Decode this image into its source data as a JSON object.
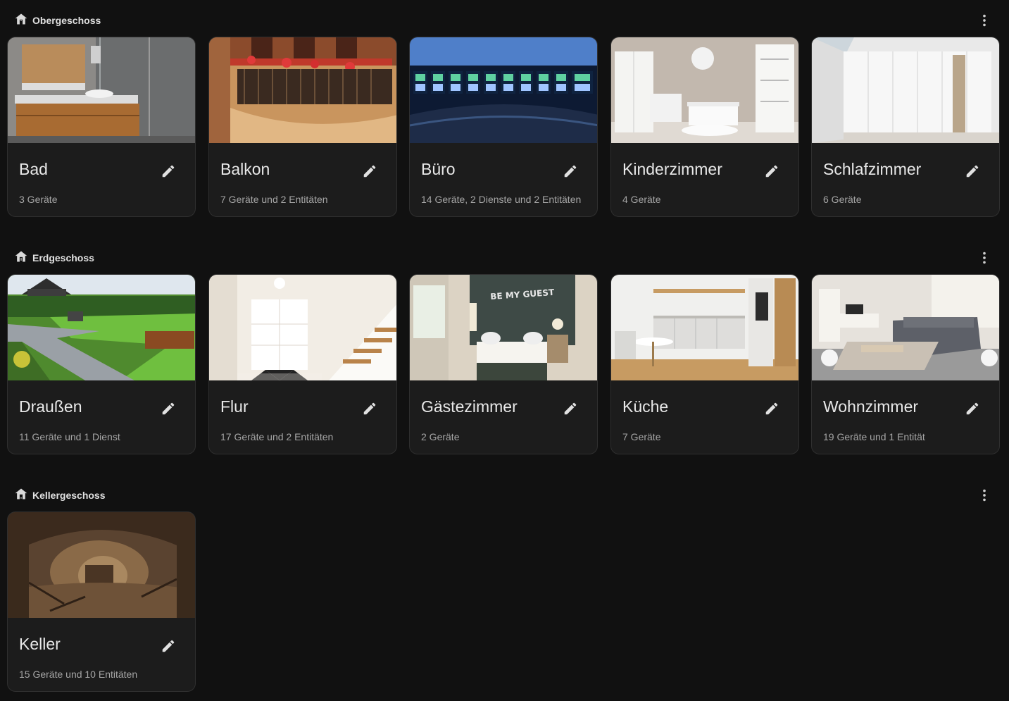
{
  "icons": {
    "floor": "home-floor-icon",
    "menu": "dots-vertical-icon",
    "edit": "pencil-icon"
  },
  "floors": [
    {
      "name": "Obergeschoss",
      "areas": [
        {
          "name": "Bad",
          "summary": "3 Geräte",
          "image": "bathroom-photo"
        },
        {
          "name": "Balkon",
          "summary": "7 Geräte und 2 Entitäten",
          "image": "balcony-photo"
        },
        {
          "name": "Büro",
          "summary": "14 Geräte, 2 Dienste und 2 Entitäten",
          "image": "control-room-photo"
        },
        {
          "name": "Kinderzimmer",
          "summary": "4 Geräte",
          "image": "kids-room-photo"
        },
        {
          "name": "Schlafzimmer",
          "summary": "6 Geräte",
          "image": "bedroom-wardrobe-photo"
        }
      ]
    },
    {
      "name": "Erdgeschoss",
      "areas": [
        {
          "name": "Draußen",
          "summary": "11 Geräte und 1 Dienst",
          "image": "garden-photo"
        },
        {
          "name": "Flur",
          "summary": "17 Geräte und 2 Entitäten",
          "image": "hallway-photo"
        },
        {
          "name": "Gästezimmer",
          "summary": "2 Geräte",
          "image": "guest-bedroom-photo",
          "image_text": "BE MY GUEST"
        },
        {
          "name": "Küche",
          "summary": "7 Geräte",
          "image": "kitchen-photo"
        },
        {
          "name": "Wohnzimmer",
          "summary": "19 Geräte und 1 Entität",
          "image": "living-room-photo"
        }
      ]
    },
    {
      "name": "Kellergeschoss",
      "areas": [
        {
          "name": "Keller",
          "summary": "15 Geräte und 10 Entitäten",
          "image": "cellar-photo"
        }
      ]
    }
  ]
}
